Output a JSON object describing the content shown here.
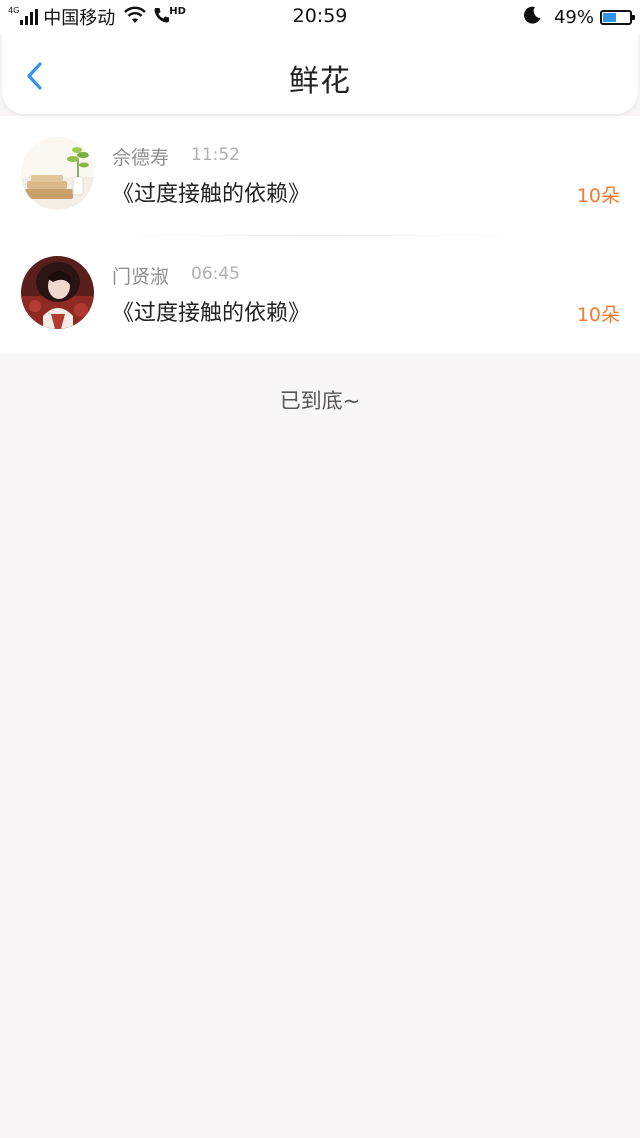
{
  "status_bar": {
    "network": "4G",
    "carrier": "中国移动",
    "hd": "HD",
    "time": "20:59",
    "battery_percent": "49%",
    "battery_level": 0.49,
    "icons": [
      "signal-icon",
      "wifi-icon",
      "call-icon",
      "moon-icon",
      "battery-icon"
    ]
  },
  "header": {
    "title": "鲜花",
    "back_icon": "chevron-left-icon"
  },
  "records": [
    {
      "name": "佘德寿",
      "time": "11:52",
      "book": "《过度接触的依赖》",
      "count": "10朵"
    },
    {
      "name": "门贤淑",
      "time": "06:45",
      "book": "《过度接触的依赖》",
      "count": "10朵"
    }
  ],
  "footer": {
    "end_text": "已到底~"
  },
  "colors": {
    "accent_blue": "#2f93f0",
    "count_orange": "#f57a2e",
    "page_background": "#f8f6f7"
  }
}
